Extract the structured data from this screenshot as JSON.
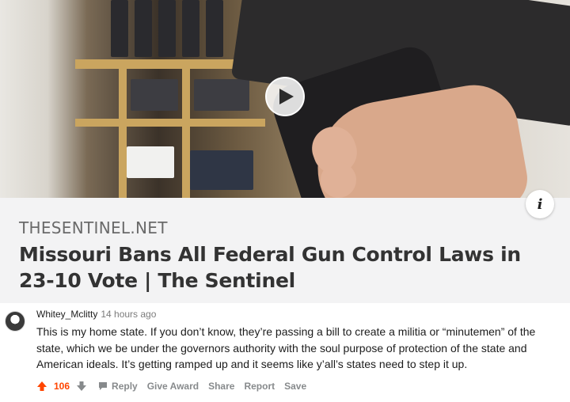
{
  "link": {
    "domain": "THESENTINEL.NET",
    "title": "Missouri Bans All Federal Gun Control Laws in 23-10 Vote | The Sentinel",
    "info_label": "i"
  },
  "comment": {
    "author": "Whitey_Mclitty",
    "time": "14 hours ago",
    "body": "This is my home state. If you don’t know, they’re passing a bill to create a militia or “minutemen” of the state, which we be under the governors authority with the soul purpose of protection of the state and American ideals. It’s getting ramped up and it seems like y’all’s states need to step it up.",
    "score": "106",
    "actions": {
      "reply": "Reply",
      "give_award": "Give Award",
      "share": "Share",
      "report": "Report",
      "save": "Save"
    }
  },
  "colors": {
    "upvote": "#ff4500",
    "action_text": "#878a8c",
    "card_bg": "#f3f3f4"
  }
}
